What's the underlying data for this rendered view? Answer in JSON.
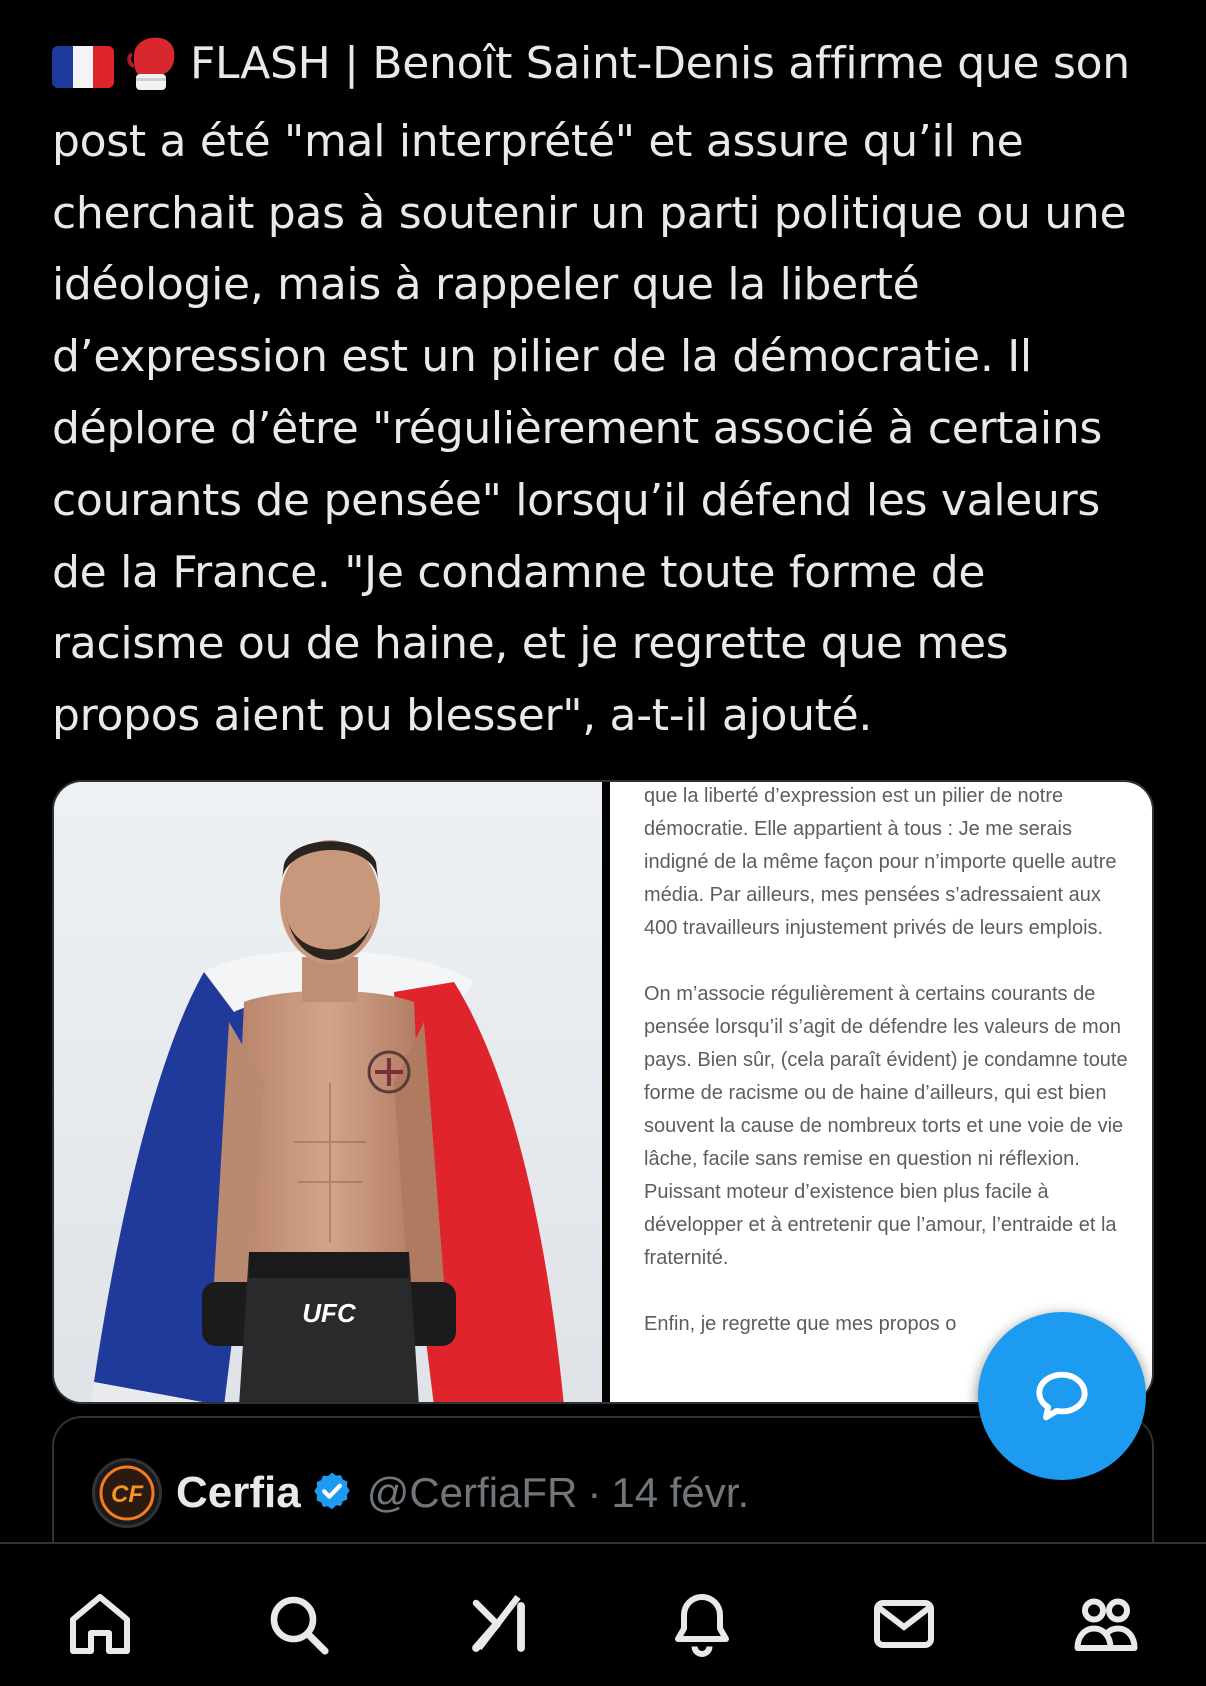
{
  "post": {
    "flag_emoji": "🇫🇷",
    "glove_emoji": "🥊",
    "text": "FLASH | Benoît Saint-Denis affirme que son post a été \"mal interprété\" et assure qu’il ne cherchait pas à soutenir un parti politique ou une idéologie, mais à rappeler que la liberté d’expression est un pilier de la démocratie. Il déplore d’être \"régulièrement associé à certains courants de pensée\" lorsqu’il défend les valeurs de la France. \"Je condamne toute forme de racisme ou de haine, et je regrette que mes propos aient pu blesser\", a-t-il ajouté."
  },
  "media": {
    "photo_shorts_label": "UFC",
    "doc_paragraphs": [
      "que la liberté d’expression est un pilier de notre démocratie. Elle appartient à tous : Je me serais indigné de la même façon pour n’importe quelle autre média. Par ailleurs, mes pensées s’adressaient aux 400 travailleurs injustement privés de leurs emplois.",
      "On m’associe régulièrement à certains courants de pensée lorsqu’il s’agit de défendre les valeurs de mon pays. Bien sûr, (cela paraît évident) je condamne toute forme de racisme ou de haine d’ailleurs, qui est bien souvent la cause de nombreux torts et une voie de vie lâche, facile sans remise en question ni réflexion. Puissant moteur d’existence bien plus facile à développer et à entretenir que l’amour, l’entraide et la fraternité.",
      "Enfin, je regrette que mes propos o"
    ]
  },
  "quote": {
    "avatar_text": "CF",
    "name": "Cerfia",
    "handle": "@CerfiaFR",
    "separator": "·",
    "date": "14 févr."
  },
  "fab": {
    "icon": "compose-reply-icon"
  },
  "nav": {
    "items": [
      "home-icon",
      "search-icon",
      "grok-icon",
      "notifications-icon",
      "messages-icon",
      "communities-icon"
    ]
  },
  "colors": {
    "background": "#000000",
    "text": "#e7e9ea",
    "muted": "#71767b",
    "accent": "#1d9bf0",
    "border": "#2f3336",
    "flag_blue": "#1f3a9a",
    "flag_red": "#e0242b"
  }
}
